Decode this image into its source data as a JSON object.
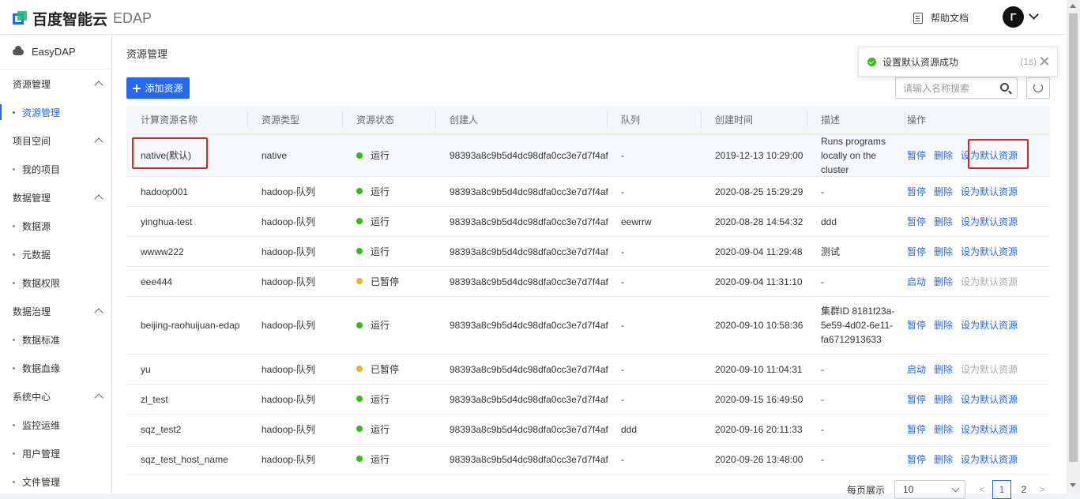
{
  "header": {
    "brand": "百度智能云",
    "product": "EDAP",
    "help_label": "帮助文档",
    "avatar_letter": "Γ"
  },
  "sidebar": {
    "app_name": "EasyDAP",
    "groups": [
      {
        "label": "资源管理",
        "items": [
          {
            "label": "资源管理",
            "active": true
          }
        ]
      },
      {
        "label": "项目空间",
        "items": [
          {
            "label": "我的项目"
          }
        ]
      },
      {
        "label": "数据管理",
        "items": [
          {
            "label": "数据源"
          },
          {
            "label": "元数据"
          },
          {
            "label": "数据权限"
          }
        ]
      },
      {
        "label": "数据治理",
        "items": [
          {
            "label": "数据标准"
          },
          {
            "label": "数据血缘"
          }
        ]
      },
      {
        "label": "系统中心",
        "items": [
          {
            "label": "监控运维"
          },
          {
            "label": "用户管理"
          },
          {
            "label": "文件管理"
          }
        ]
      }
    ]
  },
  "main": {
    "title": "资源管理",
    "add_button": "添加资源",
    "search_placeholder": "请输入名称搜索"
  },
  "table": {
    "columns": [
      "计算资源名称",
      "资源类型",
      "资源状态",
      "创建人",
      "队列",
      "创建时间",
      "描述",
      "操作"
    ],
    "rows": [
      {
        "name": "native(默认)",
        "type": "native",
        "status": "运行",
        "status_color": "#30bf13",
        "creator": "98393a8c9b5d4dc98dfa0cc3e7d7f4af",
        "queue": "-",
        "created": "2019-12-13 10:29:00",
        "desc": "Runs programs locally on the cluster",
        "op1": "暂停",
        "op2": "删除",
        "op3": "设为默认资源",
        "op3_disabled": false
      },
      {
        "name": "hadoop001",
        "type": "hadoop-队列",
        "status": "运行",
        "status_color": "#30bf13",
        "creator": "98393a8c9b5d4dc98dfa0cc3e7d7f4af",
        "queue": "-",
        "created": "2020-08-25 15:29:29",
        "desc": "-",
        "op1": "暂停",
        "op2": "删除",
        "op3": "设为默认资源",
        "op3_disabled": false
      },
      {
        "name": "yinghua-test",
        "type": "hadoop-队列",
        "status": "运行",
        "status_color": "#30bf13",
        "creator": "98393a8c9b5d4dc98dfa0cc3e7d7f4af",
        "queue": "eewrrw",
        "created": "2020-08-28 14:54:32",
        "desc": "ddd",
        "op1": "暂停",
        "op2": "删除",
        "op3": "设为默认资源",
        "op3_disabled": false
      },
      {
        "name": "wwww222",
        "type": "hadoop-队列",
        "status": "运行",
        "status_color": "#30bf13",
        "creator": "98393a8c9b5d4dc98dfa0cc3e7d7f4af",
        "queue": "-",
        "created": "2020-09-04 11:29:48",
        "desc": "测试",
        "op1": "暂停",
        "op2": "删除",
        "op3": "设为默认资源",
        "op3_disabled": false
      },
      {
        "name": "eee444",
        "type": "hadoop-队列",
        "status": "已暂停",
        "status_color": "#f0b323",
        "creator": "98393a8c9b5d4dc98dfa0cc3e7d7f4af",
        "queue": "-",
        "created": "2020-09-04 11:31:10",
        "desc": "-",
        "op1": "启动",
        "op2": "删除",
        "op3": "设为默认资源",
        "op3_disabled": true
      },
      {
        "name": "beijing-raohuijuan-edap",
        "type": "hadoop-队列",
        "status": "运行",
        "status_color": "#30bf13",
        "creator": "98393a8c9b5d4dc98dfa0cc3e7d7f4af",
        "queue": "-",
        "created": "2020-09-10 10:58:36",
        "desc": "集群ID 8181f23a-5e59-4d02-6e11-fa6712913633",
        "op1": "暂停",
        "op2": "删除",
        "op3": "设为默认资源",
        "op3_disabled": false
      },
      {
        "name": "yu",
        "type": "hadoop-队列",
        "status": "已暂停",
        "status_color": "#f0b323",
        "creator": "98393a8c9b5d4dc98dfa0cc3e7d7f4af",
        "queue": "-",
        "created": "2020-09-10 11:04:31",
        "desc": "-",
        "op1": "启动",
        "op2": "删除",
        "op3": "设为默认资源",
        "op3_disabled": true
      },
      {
        "name": "zl_test",
        "type": "hadoop-队列",
        "status": "运行",
        "status_color": "#30bf13",
        "creator": "98393a8c9b5d4dc98dfa0cc3e7d7f4af",
        "queue": "-",
        "created": "2020-09-15 16:49:50",
        "desc": "-",
        "op1": "暂停",
        "op2": "删除",
        "op3": "设为默认资源",
        "op3_disabled": false
      },
      {
        "name": "sqz_test2",
        "type": "hadoop-队列",
        "status": "运行",
        "status_color": "#30bf13",
        "creator": "98393a8c9b5d4dc98dfa0cc3e7d7f4af",
        "queue": "ddd",
        "created": "2020-09-16 20:11:33",
        "desc": "-",
        "op1": "暂停",
        "op2": "删除",
        "op3": "设为默认资源",
        "op3_disabled": false
      },
      {
        "name": "sqz_test_host_name",
        "type": "hadoop-队列",
        "status": "运行",
        "status_color": "#30bf13",
        "creator": "98393a8c9b5d4dc98dfa0cc3e7d7f4af",
        "queue": "-",
        "created": "2020-09-26 13:48:00",
        "desc": "-",
        "op1": "暂停",
        "op2": "删除",
        "op3": "设为默认资源",
        "op3_disabled": false
      }
    ]
  },
  "pagination": {
    "page_size_label": "每页展示",
    "page_size": "10",
    "current_page": "1",
    "next_page": "2",
    "prev_arrow": "<",
    "next_arrow": ">"
  },
  "toast": {
    "message": "设置默认资源成功",
    "countdown": "(1s)"
  }
}
